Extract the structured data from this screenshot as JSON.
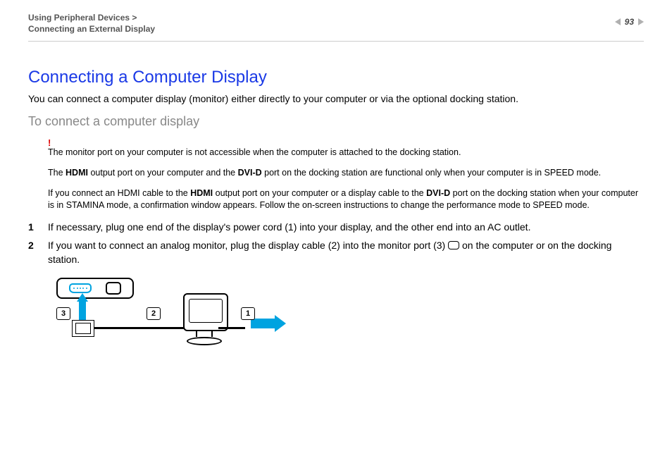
{
  "header": {
    "breadcrumb_top": "Using Peripheral Devices >",
    "breadcrumb_sub": "Connecting an External Display",
    "page_number": "93"
  },
  "title": "Connecting a Computer Display",
  "intro": "You can connect a computer display (monitor) either directly to your computer or via the optional docking station.",
  "subheading": "To connect a computer display",
  "bang": "!",
  "notes": {
    "n1": "The monitor port on your computer is not accessible when the computer is attached to the docking station.",
    "n2a": "The ",
    "n2b": "HDMI",
    "n2c": " output port on your computer and the ",
    "n2d": "DVI-D",
    "n2e": " port on the docking station are functional only when your computer is in SPEED mode.",
    "n3a": "If you connect an HDMI cable to the ",
    "n3b": "HDMI",
    "n3c": " output port on your computer or a display cable to the ",
    "n3d": "DVI-D",
    "n3e": " port on the docking station when your computer is in STAMINA mode, a confirmation window appears. Follow the on-screen instructions to change the performance mode to SPEED mode."
  },
  "steps": {
    "s1": "If necessary, plug one end of the display's power cord (1) into your display, and the other end into an AC outlet.",
    "s2a": "If you want to connect an analog monitor, plug the display cable (2) into the monitor port (3) ",
    "s2b": " on the computer or on the docking station."
  },
  "diagram": {
    "callout1": "1",
    "callout2": "2",
    "callout3": "3"
  }
}
